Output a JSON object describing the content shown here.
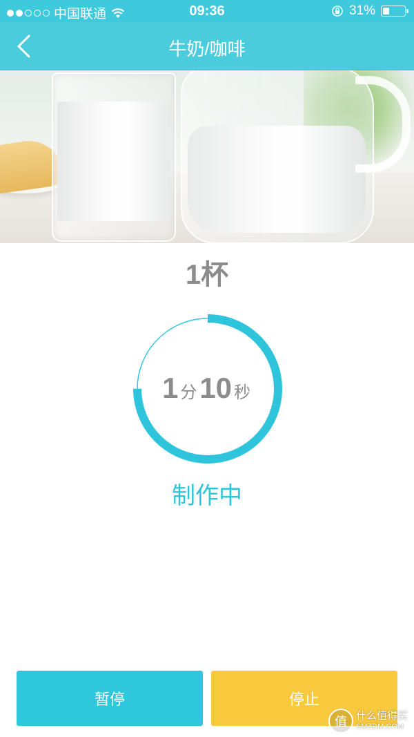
{
  "status_bar": {
    "carrier": "中国联通",
    "time": "09:36",
    "battery_percent": "31%",
    "battery_level": 0.31,
    "signal_strength": 2,
    "signal_total": 5
  },
  "nav": {
    "title": "牛奶/咖啡"
  },
  "order": {
    "cups_value": "1",
    "cups_unit": "杯"
  },
  "timer": {
    "minutes": "1",
    "minutes_unit": "分",
    "seconds": "10",
    "seconds_unit": "秒",
    "progress": 0.75
  },
  "status": {
    "label": "制作中"
  },
  "buttons": {
    "pause_label": "暂停",
    "stop_label": "停止"
  },
  "watermark": {
    "badge": "值",
    "text_cn": "什么值得买",
    "text_en": "SMZDM.COM"
  },
  "colors": {
    "accent": "#2ec5dc",
    "stop": "#f9c93d",
    "text_gray": "#8c8c8c"
  }
}
